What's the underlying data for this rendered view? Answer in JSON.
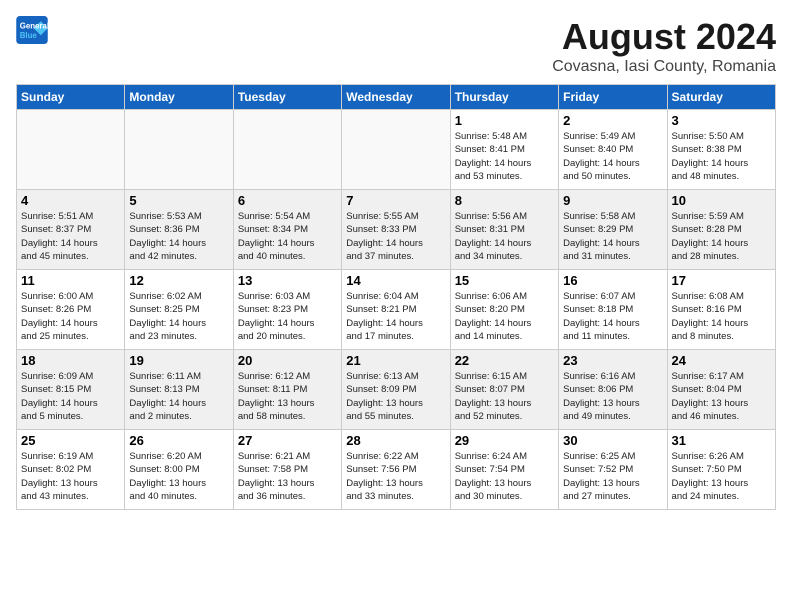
{
  "logo": {
    "line1": "General",
    "line2": "Blue"
  },
  "title": "August 2024",
  "subtitle": "Covasna, Iasi County, Romania",
  "days_of_week": [
    "Sunday",
    "Monday",
    "Tuesday",
    "Wednesday",
    "Thursday",
    "Friday",
    "Saturday"
  ],
  "weeks": [
    [
      {
        "day": "",
        "text": "",
        "shade": "empty"
      },
      {
        "day": "",
        "text": "",
        "shade": "empty"
      },
      {
        "day": "",
        "text": "",
        "shade": "empty"
      },
      {
        "day": "",
        "text": "",
        "shade": "empty"
      },
      {
        "day": "1",
        "text": "Sunrise: 5:48 AM\nSunset: 8:41 PM\nDaylight: 14 hours\nand 53 minutes.",
        "shade": "filled"
      },
      {
        "day": "2",
        "text": "Sunrise: 5:49 AM\nSunset: 8:40 PM\nDaylight: 14 hours\nand 50 minutes.",
        "shade": "filled"
      },
      {
        "day": "3",
        "text": "Sunrise: 5:50 AM\nSunset: 8:38 PM\nDaylight: 14 hours\nand 48 minutes.",
        "shade": "filled"
      }
    ],
    [
      {
        "day": "4",
        "text": "Sunrise: 5:51 AM\nSunset: 8:37 PM\nDaylight: 14 hours\nand 45 minutes.",
        "shade": "shaded"
      },
      {
        "day": "5",
        "text": "Sunrise: 5:53 AM\nSunset: 8:36 PM\nDaylight: 14 hours\nand 42 minutes.",
        "shade": "shaded"
      },
      {
        "day": "6",
        "text": "Sunrise: 5:54 AM\nSunset: 8:34 PM\nDaylight: 14 hours\nand 40 minutes.",
        "shade": "shaded"
      },
      {
        "day": "7",
        "text": "Sunrise: 5:55 AM\nSunset: 8:33 PM\nDaylight: 14 hours\nand 37 minutes.",
        "shade": "shaded"
      },
      {
        "day": "8",
        "text": "Sunrise: 5:56 AM\nSunset: 8:31 PM\nDaylight: 14 hours\nand 34 minutes.",
        "shade": "shaded"
      },
      {
        "day": "9",
        "text": "Sunrise: 5:58 AM\nSunset: 8:29 PM\nDaylight: 14 hours\nand 31 minutes.",
        "shade": "shaded"
      },
      {
        "day": "10",
        "text": "Sunrise: 5:59 AM\nSunset: 8:28 PM\nDaylight: 14 hours\nand 28 minutes.",
        "shade": "shaded"
      }
    ],
    [
      {
        "day": "11",
        "text": "Sunrise: 6:00 AM\nSunset: 8:26 PM\nDaylight: 14 hours\nand 25 minutes.",
        "shade": "filled"
      },
      {
        "day": "12",
        "text": "Sunrise: 6:02 AM\nSunset: 8:25 PM\nDaylight: 14 hours\nand 23 minutes.",
        "shade": "filled"
      },
      {
        "day": "13",
        "text": "Sunrise: 6:03 AM\nSunset: 8:23 PM\nDaylight: 14 hours\nand 20 minutes.",
        "shade": "filled"
      },
      {
        "day": "14",
        "text": "Sunrise: 6:04 AM\nSunset: 8:21 PM\nDaylight: 14 hours\nand 17 minutes.",
        "shade": "filled"
      },
      {
        "day": "15",
        "text": "Sunrise: 6:06 AM\nSunset: 8:20 PM\nDaylight: 14 hours\nand 14 minutes.",
        "shade": "filled"
      },
      {
        "day": "16",
        "text": "Sunrise: 6:07 AM\nSunset: 8:18 PM\nDaylight: 14 hours\nand 11 minutes.",
        "shade": "filled"
      },
      {
        "day": "17",
        "text": "Sunrise: 6:08 AM\nSunset: 8:16 PM\nDaylight: 14 hours\nand 8 minutes.",
        "shade": "filled"
      }
    ],
    [
      {
        "day": "18",
        "text": "Sunrise: 6:09 AM\nSunset: 8:15 PM\nDaylight: 14 hours\nand 5 minutes.",
        "shade": "shaded"
      },
      {
        "day": "19",
        "text": "Sunrise: 6:11 AM\nSunset: 8:13 PM\nDaylight: 14 hours\nand 2 minutes.",
        "shade": "shaded"
      },
      {
        "day": "20",
        "text": "Sunrise: 6:12 AM\nSunset: 8:11 PM\nDaylight: 13 hours\nand 58 minutes.",
        "shade": "shaded"
      },
      {
        "day": "21",
        "text": "Sunrise: 6:13 AM\nSunset: 8:09 PM\nDaylight: 13 hours\nand 55 minutes.",
        "shade": "shaded"
      },
      {
        "day": "22",
        "text": "Sunrise: 6:15 AM\nSunset: 8:07 PM\nDaylight: 13 hours\nand 52 minutes.",
        "shade": "shaded"
      },
      {
        "day": "23",
        "text": "Sunrise: 6:16 AM\nSunset: 8:06 PM\nDaylight: 13 hours\nand 49 minutes.",
        "shade": "shaded"
      },
      {
        "day": "24",
        "text": "Sunrise: 6:17 AM\nSunset: 8:04 PM\nDaylight: 13 hours\nand 46 minutes.",
        "shade": "shaded"
      }
    ],
    [
      {
        "day": "25",
        "text": "Sunrise: 6:19 AM\nSunset: 8:02 PM\nDaylight: 13 hours\nand 43 minutes.",
        "shade": "filled"
      },
      {
        "day": "26",
        "text": "Sunrise: 6:20 AM\nSunset: 8:00 PM\nDaylight: 13 hours\nand 40 minutes.",
        "shade": "filled"
      },
      {
        "day": "27",
        "text": "Sunrise: 6:21 AM\nSunset: 7:58 PM\nDaylight: 13 hours\nand 36 minutes.",
        "shade": "filled"
      },
      {
        "day": "28",
        "text": "Sunrise: 6:22 AM\nSunset: 7:56 PM\nDaylight: 13 hours\nand 33 minutes.",
        "shade": "filled"
      },
      {
        "day": "29",
        "text": "Sunrise: 6:24 AM\nSunset: 7:54 PM\nDaylight: 13 hours\nand 30 minutes.",
        "shade": "filled"
      },
      {
        "day": "30",
        "text": "Sunrise: 6:25 AM\nSunset: 7:52 PM\nDaylight: 13 hours\nand 27 minutes.",
        "shade": "filled"
      },
      {
        "day": "31",
        "text": "Sunrise: 6:26 AM\nSunset: 7:50 PM\nDaylight: 13 hours\nand 24 minutes.",
        "shade": "filled"
      }
    ]
  ]
}
